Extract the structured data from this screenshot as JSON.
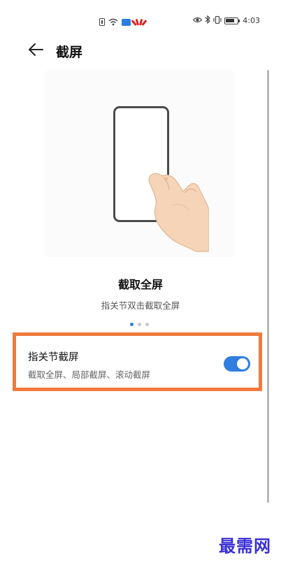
{
  "status_bar": {
    "time": "4:03"
  },
  "header": {
    "title": "截屏"
  },
  "feature": {
    "title": "截取全屏",
    "description": "指关节双击截取全屏",
    "page_index": 1,
    "page_count": 3
  },
  "setting": {
    "title": "指关节截屏",
    "subtitle": "截取全屏、局部截屏、滚动截屏",
    "enabled": true
  },
  "watermark": {
    "text": "最需网"
  },
  "colors": {
    "accent": "#2f7ee0",
    "highlight": "#f07a3c",
    "watermark": "#3a2fd6"
  }
}
